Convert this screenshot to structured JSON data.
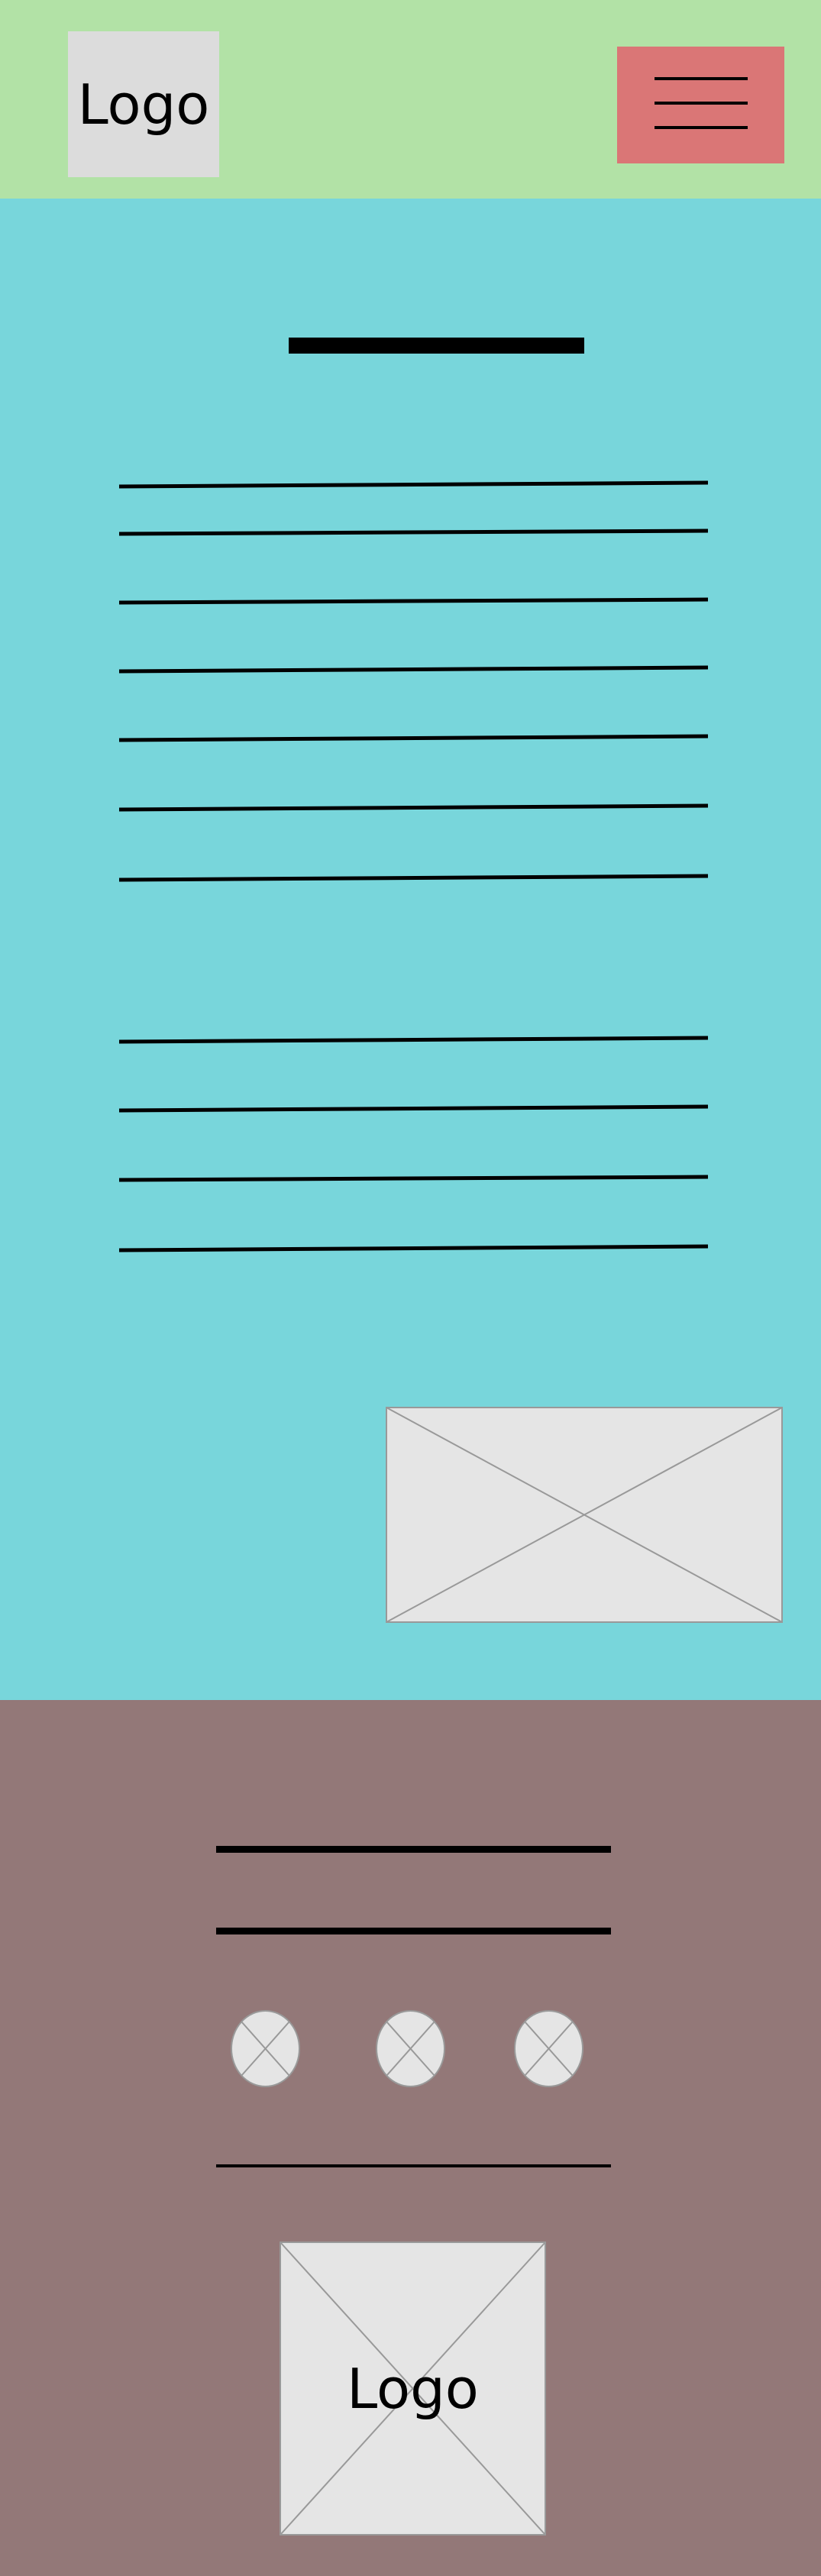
{
  "header": {
    "logo_text": "Logo",
    "menu_icon": "hamburger-icon"
  },
  "main": {
    "image_icon": "image-placeholder-icon"
  },
  "footer": {
    "social_icons": [
      "social-icon-1",
      "social-icon-2",
      "social-icon-3"
    ],
    "logo_text": "Logo"
  },
  "colors": {
    "header_bg": "#b2e2a6",
    "menu_button": "#da7676",
    "main_bg": "#78d6db",
    "footer_bg": "#937878",
    "placeholder_fill": "#e5e5e5",
    "placeholder_stroke": "#999999"
  }
}
